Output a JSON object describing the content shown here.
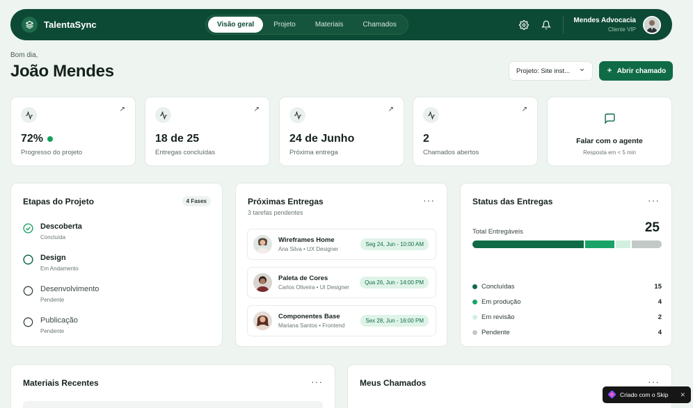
{
  "brand": {
    "name": "TalentaSync"
  },
  "nav": {
    "tabs": [
      "Visão geral",
      "Projeto",
      "Materiais",
      "Chamados"
    ]
  },
  "account": {
    "company": "Mendes Advocacia",
    "role": "Cliente VIP"
  },
  "greeting": {
    "hello": "Bom dia,",
    "name": "João Mendes"
  },
  "actions": {
    "project_select": "Projeto: Site inst...",
    "open_ticket": "Abrir chamado"
  },
  "kpis": [
    {
      "value": "72%",
      "label": "Progresso do projeto"
    },
    {
      "value": "18 de 25",
      "label": "Entregas concluídas"
    },
    {
      "value": "24 de Junho",
      "label": "Próxima entrega"
    },
    {
      "value": "2",
      "label": "Chamados abertos"
    }
  ],
  "agent": {
    "title": "Falar com o agente",
    "subtitle": "Resposta em < 5 min"
  },
  "stages": {
    "title": "Etapas do Projeto",
    "badge": "4 Fases",
    "items": [
      {
        "name": "Descoberta",
        "status": "Concluída"
      },
      {
        "name": "Design",
        "status": "Em Andamento"
      },
      {
        "name": "Desenvolvimento",
        "status": "Pendente"
      },
      {
        "name": "Publicação",
        "status": "Pendente"
      }
    ]
  },
  "upcoming": {
    "title": "Próximas Entregas",
    "subtitle": "3 tarefas pendentes",
    "items": [
      {
        "name": "Wireframes Home",
        "by": "Ana Silva • UX Designer",
        "date": "Seg 24, Jun - 10:00 AM"
      },
      {
        "name": "Paleta de Cores",
        "by": "Carlos Oliveira • UI Designer",
        "date": "Qua 26, Jun - 14:00 PM"
      },
      {
        "name": "Componentes Base",
        "by": "Mariana Santos • Frontend",
        "date": "Sex 28, Jun - 16:00 PM"
      }
    ]
  },
  "status": {
    "title": "Status das Entregas",
    "total_label": "Total Entregáveis",
    "total": "25",
    "items": [
      {
        "label": "Concluídas",
        "value": "15",
        "color": "#0f6b46"
      },
      {
        "label": "Em produção",
        "value": "4",
        "color": "#19a467"
      },
      {
        "label": "Em revisão",
        "value": "2",
        "color": "#d2f0e0"
      },
      {
        "label": "Pendente",
        "value": "4",
        "color": "#c3c9c6"
      }
    ]
  },
  "materials": {
    "title": "Materiais Recentes"
  },
  "tickets": {
    "title": "Meus Chamados"
  },
  "skip_badge": {
    "label": "Criado com o Skip"
  }
}
